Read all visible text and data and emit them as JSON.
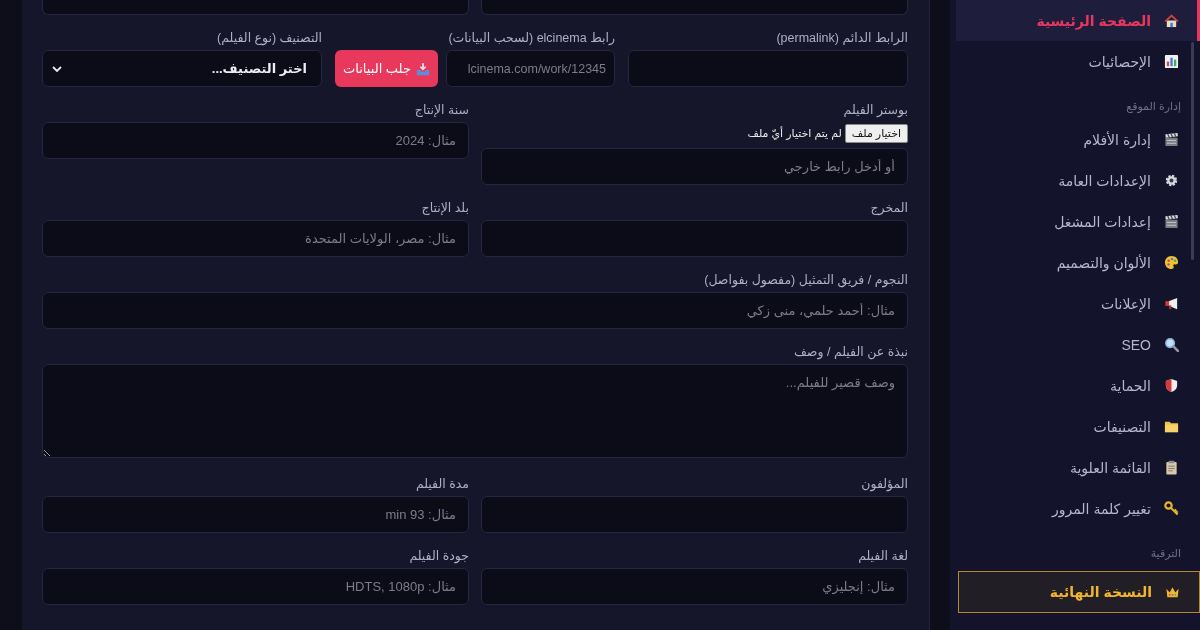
{
  "sidebar": {
    "groups": [
      {
        "items": [
          {
            "kind": "link",
            "label": "الصفحة الرئيسية",
            "selected": true
          },
          {
            "kind": "link",
            "label": "الإحصائيات",
            "selected": false
          }
        ]
      },
      {
        "title": "إدارة الموقع",
        "items": [
          {
            "kind": "link",
            "label": "إدارة الأفلام",
            "selected": false
          },
          {
            "kind": "link",
            "label": "الإعدادات العامة",
            "selected": false
          },
          {
            "kind": "link",
            "label": "إعدادات المشغل",
            "selected": false
          },
          {
            "kind": "link",
            "label": "الألوان والتصميم",
            "selected": false
          },
          {
            "kind": "link",
            "label": "الإعلانات",
            "selected": false
          },
          {
            "kind": "link",
            "label": "SEO",
            "selected": false
          },
          {
            "kind": "link",
            "label": "الحماية",
            "selected": false
          },
          {
            "kind": "link",
            "label": "التصنيفات",
            "selected": false
          },
          {
            "kind": "link",
            "label": "القائمة العلوية",
            "selected": false
          },
          {
            "kind": "link",
            "label": "تغيير كلمة المرور",
            "selected": false
          }
        ]
      },
      {
        "title": "الترقية",
        "items": [
          {
            "kind": "premium",
            "label": "النسخة النهائية",
            "selected": false
          }
        ]
      }
    ]
  },
  "form": {
    "rows": [
      {
        "fields": [
          {
            "kind": "cut_input"
          },
          {
            "kind": "cut_input"
          }
        ]
      },
      {
        "fields": [
          {
            "kind": "text",
            "label": "الرابط الدائم (permalink)"
          },
          {
            "kind": "fetch",
            "label": "رابط elcinema (لسحب البيانات)",
            "placeholder": "lcinema.com/work/12345",
            "button": "جلب البيانات"
          },
          {
            "kind": "select",
            "label": "التصنيف (نوع الفيلم)",
            "value": "اختر التصنيف..."
          }
        ]
      },
      {
        "fields": [
          {
            "kind": "file",
            "label": "بوستر الفيلم",
            "file_button": "اختيار ملف",
            "file_status": "لم يتم اختيار أيّ ملف",
            "placeholder": "أو أدخل رابط خارجي"
          },
          {
            "kind": "text",
            "label": "سنة الإنتاج",
            "placeholder": "مثال: 2024"
          }
        ]
      },
      {
        "fields": [
          {
            "kind": "text",
            "label": "المخرج"
          },
          {
            "kind": "text",
            "label": "بلد الإنتاج",
            "placeholder": "مثال: مصر، الولايات المتحدة"
          }
        ]
      },
      {
        "fields": [
          {
            "kind": "text",
            "label": "النجوم / فريق التمثيل (مفصول بفواصل)",
            "placeholder": "مثال: أحمد حلمي، منى زكي"
          }
        ]
      },
      {
        "fields": [
          {
            "kind": "textarea",
            "label": "نبذة عن الفيلم / وصف",
            "placeholder": "وصف قصير للفيلم..."
          }
        ]
      },
      {
        "fields": [
          {
            "kind": "text",
            "label": "المؤلفون"
          },
          {
            "kind": "text",
            "label": "مدة الفيلم",
            "placeholder": "مثال: 93 min"
          }
        ]
      },
      {
        "fields": [
          {
            "kind": "text",
            "label": "لغة الفيلم",
            "placeholder": "مثال: إنجليزي"
          },
          {
            "kind": "text",
            "label": "جودة الفيلم",
            "placeholder": "مثال: HDTS, 1080p"
          }
        ]
      }
    ]
  }
}
